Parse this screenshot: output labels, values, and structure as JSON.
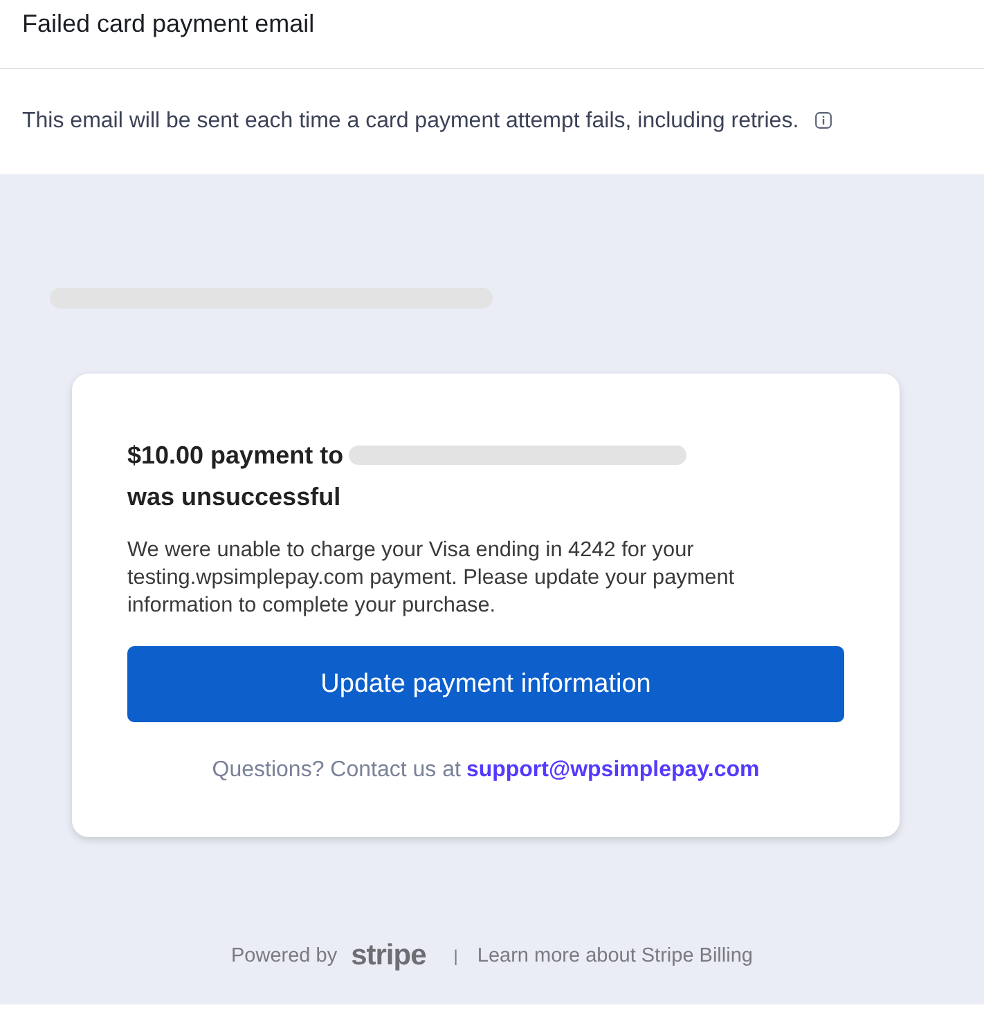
{
  "header": {
    "title": "Failed card payment email",
    "description": "This email will be sent each time a card payment attempt fails, including retries."
  },
  "email": {
    "heading_start": "$10.00 payment to",
    "heading_end": "was unsuccessful",
    "body": "We were unable to charge your Visa ending in 4242 for your testing.wpsimplepay.com payment. Please update your payment information to complete your purchase.",
    "button": "Update payment information",
    "questions": "Questions? Contact us at",
    "support_link": "support@wpsimplepay.com"
  },
  "footer": {
    "powered_by": "Powered by",
    "logo": "stripe",
    "separator": "|",
    "learn_more": "Learn more about Stripe Billing"
  }
}
